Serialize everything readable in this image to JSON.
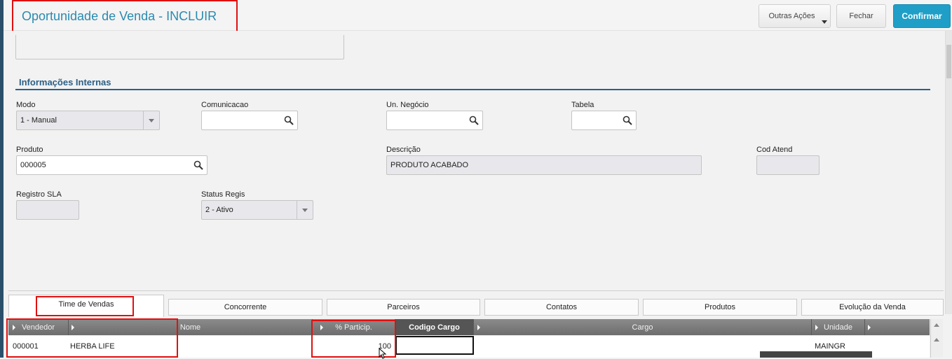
{
  "header": {
    "title": "Oportunidade de Venda - INCLUIR",
    "buttons": {
      "outras_acoes": "Outras Ações",
      "fechar": "Fechar",
      "confirmar": "Confirmar"
    }
  },
  "colors": {
    "accent": "#1f9fc7",
    "title": "#2a8ab0",
    "section": "#2a5f86",
    "highlight": "#e01010"
  },
  "section": {
    "title": "Informações Internas"
  },
  "fields": {
    "modo": {
      "label": "Modo",
      "value": "1 - Manual"
    },
    "comunicacao": {
      "label": "Comunicacao",
      "value": ""
    },
    "un_negocio": {
      "label": "Un. Negócio",
      "value": ""
    },
    "tabela": {
      "label": "Tabela",
      "value": ""
    },
    "produto": {
      "label": "Produto",
      "value": "000005"
    },
    "descricao": {
      "label": "Descrição",
      "value": "PRODUTO ACABADO"
    },
    "cod_atend": {
      "label": "Cod Atend",
      "value": ""
    },
    "registro_sla": {
      "label": "Registro SLA",
      "value": ""
    },
    "status_regis": {
      "label": "Status Regis",
      "value": "2 - Ativo"
    }
  },
  "tabs": [
    "Time de Vendas",
    "Concorrente",
    "Parceiros",
    "Contatos",
    "Produtos",
    "Evolução da Venda"
  ],
  "grid": {
    "columns": [
      "Vendedor",
      "Nome",
      "% Particip.",
      "Codigo Cargo",
      "Cargo",
      "Unidade"
    ],
    "rows": [
      {
        "vendedor": "000001",
        "nome": "HERBA LIFE",
        "particip": "100",
        "codigo_cargo": "",
        "cargo": "",
        "unidade": "MAINGR"
      }
    ]
  },
  "icons": {
    "lookup": "magnifier-icon",
    "dropdown": "chevron-down-icon"
  }
}
